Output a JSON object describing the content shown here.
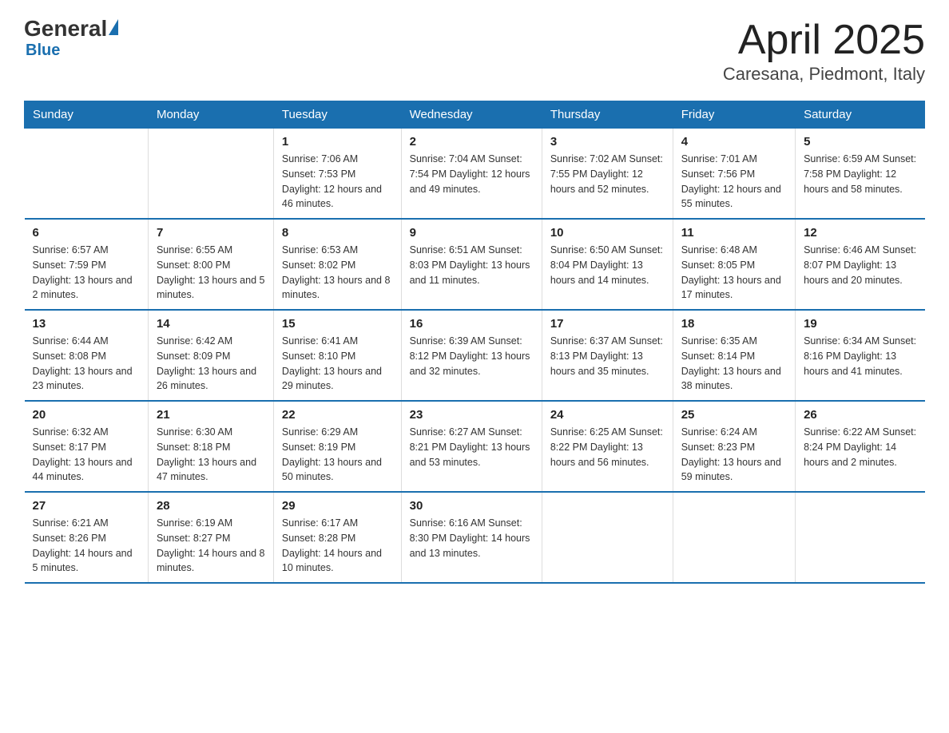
{
  "logo": {
    "general": "General",
    "blue": "Blue"
  },
  "title": "April 2025",
  "subtitle": "Caresana, Piedmont, Italy",
  "days_of_week": [
    "Sunday",
    "Monday",
    "Tuesday",
    "Wednesday",
    "Thursday",
    "Friday",
    "Saturday"
  ],
  "weeks": [
    [
      {
        "day": "",
        "info": ""
      },
      {
        "day": "",
        "info": ""
      },
      {
        "day": "1",
        "info": "Sunrise: 7:06 AM\nSunset: 7:53 PM\nDaylight: 12 hours\nand 46 minutes."
      },
      {
        "day": "2",
        "info": "Sunrise: 7:04 AM\nSunset: 7:54 PM\nDaylight: 12 hours\nand 49 minutes."
      },
      {
        "day": "3",
        "info": "Sunrise: 7:02 AM\nSunset: 7:55 PM\nDaylight: 12 hours\nand 52 minutes."
      },
      {
        "day": "4",
        "info": "Sunrise: 7:01 AM\nSunset: 7:56 PM\nDaylight: 12 hours\nand 55 minutes."
      },
      {
        "day": "5",
        "info": "Sunrise: 6:59 AM\nSunset: 7:58 PM\nDaylight: 12 hours\nand 58 minutes."
      }
    ],
    [
      {
        "day": "6",
        "info": "Sunrise: 6:57 AM\nSunset: 7:59 PM\nDaylight: 13 hours\nand 2 minutes."
      },
      {
        "day": "7",
        "info": "Sunrise: 6:55 AM\nSunset: 8:00 PM\nDaylight: 13 hours\nand 5 minutes."
      },
      {
        "day": "8",
        "info": "Sunrise: 6:53 AM\nSunset: 8:02 PM\nDaylight: 13 hours\nand 8 minutes."
      },
      {
        "day": "9",
        "info": "Sunrise: 6:51 AM\nSunset: 8:03 PM\nDaylight: 13 hours\nand 11 minutes."
      },
      {
        "day": "10",
        "info": "Sunrise: 6:50 AM\nSunset: 8:04 PM\nDaylight: 13 hours\nand 14 minutes."
      },
      {
        "day": "11",
        "info": "Sunrise: 6:48 AM\nSunset: 8:05 PM\nDaylight: 13 hours\nand 17 minutes."
      },
      {
        "day": "12",
        "info": "Sunrise: 6:46 AM\nSunset: 8:07 PM\nDaylight: 13 hours\nand 20 minutes."
      }
    ],
    [
      {
        "day": "13",
        "info": "Sunrise: 6:44 AM\nSunset: 8:08 PM\nDaylight: 13 hours\nand 23 minutes."
      },
      {
        "day": "14",
        "info": "Sunrise: 6:42 AM\nSunset: 8:09 PM\nDaylight: 13 hours\nand 26 minutes."
      },
      {
        "day": "15",
        "info": "Sunrise: 6:41 AM\nSunset: 8:10 PM\nDaylight: 13 hours\nand 29 minutes."
      },
      {
        "day": "16",
        "info": "Sunrise: 6:39 AM\nSunset: 8:12 PM\nDaylight: 13 hours\nand 32 minutes."
      },
      {
        "day": "17",
        "info": "Sunrise: 6:37 AM\nSunset: 8:13 PM\nDaylight: 13 hours\nand 35 minutes."
      },
      {
        "day": "18",
        "info": "Sunrise: 6:35 AM\nSunset: 8:14 PM\nDaylight: 13 hours\nand 38 minutes."
      },
      {
        "day": "19",
        "info": "Sunrise: 6:34 AM\nSunset: 8:16 PM\nDaylight: 13 hours\nand 41 minutes."
      }
    ],
    [
      {
        "day": "20",
        "info": "Sunrise: 6:32 AM\nSunset: 8:17 PM\nDaylight: 13 hours\nand 44 minutes."
      },
      {
        "day": "21",
        "info": "Sunrise: 6:30 AM\nSunset: 8:18 PM\nDaylight: 13 hours\nand 47 minutes."
      },
      {
        "day": "22",
        "info": "Sunrise: 6:29 AM\nSunset: 8:19 PM\nDaylight: 13 hours\nand 50 minutes."
      },
      {
        "day": "23",
        "info": "Sunrise: 6:27 AM\nSunset: 8:21 PM\nDaylight: 13 hours\nand 53 minutes."
      },
      {
        "day": "24",
        "info": "Sunrise: 6:25 AM\nSunset: 8:22 PM\nDaylight: 13 hours\nand 56 minutes."
      },
      {
        "day": "25",
        "info": "Sunrise: 6:24 AM\nSunset: 8:23 PM\nDaylight: 13 hours\nand 59 minutes."
      },
      {
        "day": "26",
        "info": "Sunrise: 6:22 AM\nSunset: 8:24 PM\nDaylight: 14 hours\nand 2 minutes."
      }
    ],
    [
      {
        "day": "27",
        "info": "Sunrise: 6:21 AM\nSunset: 8:26 PM\nDaylight: 14 hours\nand 5 minutes."
      },
      {
        "day": "28",
        "info": "Sunrise: 6:19 AM\nSunset: 8:27 PM\nDaylight: 14 hours\nand 8 minutes."
      },
      {
        "day": "29",
        "info": "Sunrise: 6:17 AM\nSunset: 8:28 PM\nDaylight: 14 hours\nand 10 minutes."
      },
      {
        "day": "30",
        "info": "Sunrise: 6:16 AM\nSunset: 8:30 PM\nDaylight: 14 hours\nand 13 minutes."
      },
      {
        "day": "",
        "info": ""
      },
      {
        "day": "",
        "info": ""
      },
      {
        "day": "",
        "info": ""
      }
    ]
  ]
}
